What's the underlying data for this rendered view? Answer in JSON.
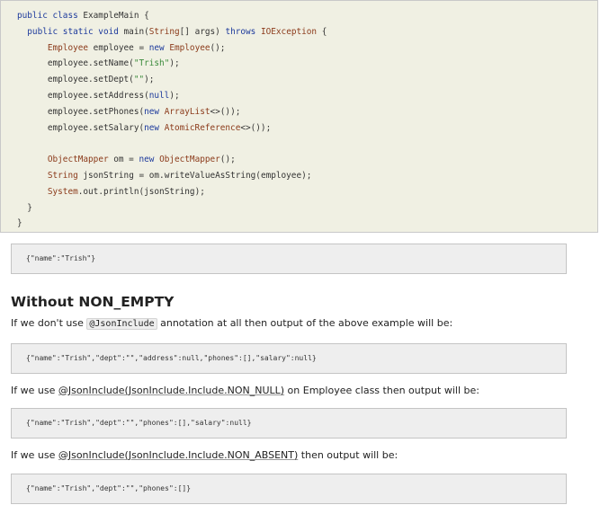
{
  "code_block": {
    "lines": [
      [
        {
          "t": "public class ",
          "c": "kw"
        },
        {
          "t": "ExampleMain {",
          "c": ""
        }
      ],
      [
        {
          "t": "  public static void ",
          "c": "kw"
        },
        {
          "t": "main(",
          "c": ""
        },
        {
          "t": "String",
          "c": "ty"
        },
        {
          "t": "[] args) ",
          "c": ""
        },
        {
          "t": "throws ",
          "c": "kw"
        },
        {
          "t": "IOException",
          "c": "ty"
        },
        {
          "t": " {",
          "c": ""
        }
      ],
      [
        {
          "t": "      ",
          "c": ""
        },
        {
          "t": "Employee",
          "c": "ty"
        },
        {
          "t": " employee = ",
          "c": ""
        },
        {
          "t": "new ",
          "c": "kw"
        },
        {
          "t": "Employee",
          "c": "ty"
        },
        {
          "t": "();",
          "c": ""
        }
      ],
      [
        {
          "t": "      employee.setName(",
          "c": ""
        },
        {
          "t": "\"Trish\"",
          "c": "st"
        },
        {
          "t": ");",
          "c": ""
        }
      ],
      [
        {
          "t": "      employee.setDept(",
          "c": ""
        },
        {
          "t": "\"\"",
          "c": "st"
        },
        {
          "t": ");",
          "c": ""
        }
      ],
      [
        {
          "t": "      employee.setAddress(",
          "c": ""
        },
        {
          "t": "null",
          "c": "kw"
        },
        {
          "t": ");",
          "c": ""
        }
      ],
      [
        {
          "t": "      employee.setPhones(",
          "c": ""
        },
        {
          "t": "new ",
          "c": "kw"
        },
        {
          "t": "ArrayList",
          "c": "ty"
        },
        {
          "t": "<>());",
          "c": ""
        }
      ],
      [
        {
          "t": "      employee.setSalary(",
          "c": ""
        },
        {
          "t": "new ",
          "c": "kw"
        },
        {
          "t": "AtomicReference",
          "c": "ty"
        },
        {
          "t": "<>());",
          "c": ""
        }
      ],
      [
        {
          "t": "",
          "c": ""
        }
      ],
      [
        {
          "t": "      ",
          "c": ""
        },
        {
          "t": "ObjectMapper",
          "c": "ty"
        },
        {
          "t": " om = ",
          "c": ""
        },
        {
          "t": "new ",
          "c": "kw"
        },
        {
          "t": "ObjectMapper",
          "c": "ty"
        },
        {
          "t": "();",
          "c": ""
        }
      ],
      [
        {
          "t": "      ",
          "c": ""
        },
        {
          "t": "String",
          "c": "ty"
        },
        {
          "t": " jsonString = om.writeValueAsString(employee);",
          "c": ""
        }
      ],
      [
        {
          "t": "      ",
          "c": ""
        },
        {
          "t": "System",
          "c": "ty"
        },
        {
          "t": ".out.println(jsonString);",
          "c": ""
        }
      ],
      [
        {
          "t": "  }",
          "c": ""
        }
      ],
      [
        {
          "t": "}",
          "c": ""
        }
      ]
    ]
  },
  "output1": "{\"name\":\"Trish\"}",
  "heading": "Without NON_EMPTY",
  "para1": {
    "before": "If we don't use ",
    "code": "@JsonInclude",
    "after": " annotation at all then output of the above example will be:"
  },
  "output2": "{\"name\":\"Trish\",\"dept\":\"\",\"address\":null,\"phones\":[],\"salary\":null}",
  "para2": {
    "before": "If we use ",
    "link": "@JsonInclude(JsonInclude.Include.NON_NULL)",
    "after": " on Employee class then output will be:"
  },
  "output3": "{\"name\":\"Trish\",\"dept\":\"\",\"phones\":[],\"salary\":null}",
  "para3": {
    "before": "If we use ",
    "link": "@JsonInclude(JsonInclude.Include.NON_ABSENT)",
    "after": " then output will be:"
  },
  "output4": "{\"name\":\"Trish\",\"dept\":\"\",\"phones\":[]}"
}
